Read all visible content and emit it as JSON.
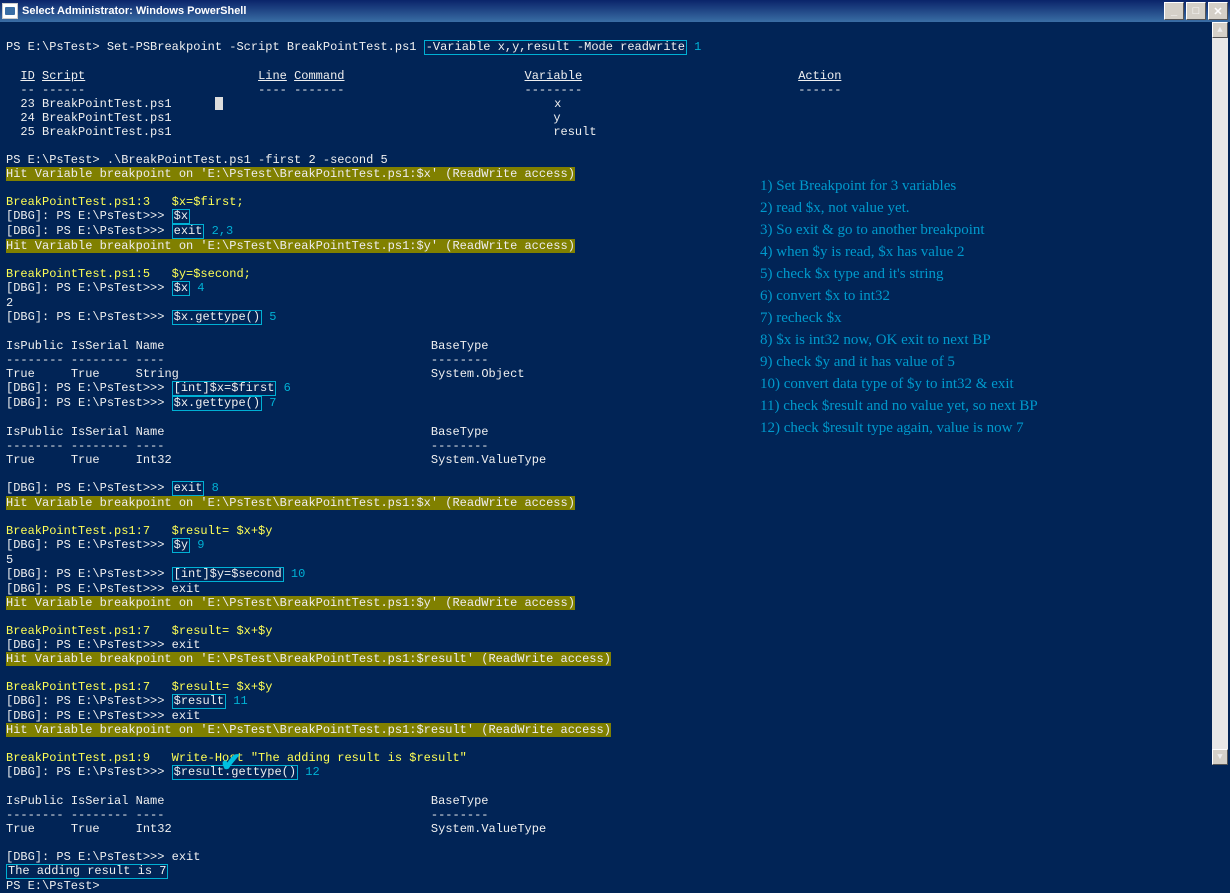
{
  "window": {
    "title": "Select Administrator: Windows PowerShell"
  },
  "cmd1": {
    "prompt": "PS E:\\PsTest> ",
    "cmd_start": "Set-PSBreakpoint -Script BreakPointTest.ps1 ",
    "boxed": "-Variable x,y,result -Mode readwrite",
    "annot": " 1"
  },
  "headers": {
    "id": "ID",
    "script": "Script",
    "line": "Line",
    "command": "Command",
    "variable": "Variable",
    "action": "Action",
    "id_u": "--",
    "script_u": "------",
    "line_u": "----",
    "command_u": "-------",
    "variable_u": "--------",
    "action_u": "------"
  },
  "rows": [
    {
      "id": "23",
      "script": "BreakPointTest.ps1",
      "var": "x"
    },
    {
      "id": "24",
      "script": "BreakPointTest.ps1",
      "var": "y"
    },
    {
      "id": "25",
      "script": "BreakPointTest.ps1",
      "var": "result"
    }
  ],
  "run": {
    "prompt": "PS E:\\PsTest> ",
    "cmd": ".\\BreakPointTest.ps1 -first 2 -second 5"
  },
  "hit_x": "Hit Variable breakpoint on 'E:\\PsTest\\BreakPointTest.ps1:$x' (ReadWrite access)",
  "hit_y": "Hit Variable breakpoint on 'E:\\PsTest\\BreakPointTest.ps1:$y' (ReadWrite access)",
  "hit_result": "Hit Variable breakpoint on 'E:\\PsTest\\BreakPointTest.ps1:$result' (ReadWrite access)",
  "line3": "BreakPointTest.ps1:3   $x=$first;",
  "line5": "BreakPointTest.ps1:5   $y=$second;",
  "line7": "BreakPointTest.ps1:7   $result= $x+$y",
  "line9": "BreakPointTest.ps1:9   Write-Host \"The adding result is $result\"",
  "dbg_prompt": "[DBG]: PS E:\\PsTest>>> ",
  "b23_x": "$x",
  "b23_exit": "exit",
  "a23": " 2,3",
  "b4_x": "$x",
  "a4": " 4",
  "v_2": "2",
  "b5_gettype": "$x.gettype()",
  "a5": " 5",
  "th": {
    "ispublic": "IsPublic",
    "isserial": "IsSerial",
    "name": "Name",
    "basetype": "BaseType",
    "ispublic_u": "--------",
    "isserial_u": "--------",
    "name_u": "----",
    "basetype_u": "--------"
  },
  "type_row_string": {
    "ispublic": "True",
    "isserial": "True",
    "name": "String",
    "basetype": "System.Object"
  },
  "type_row_int32": {
    "ispublic": "True",
    "isserial": "True",
    "name": "Int32",
    "basetype": "System.ValueType"
  },
  "b6_cast": "[int]$x=$first",
  "a6": " 6",
  "b7_gettype": "$x.gettype()",
  "a7": " 7",
  "b8_exit": "exit",
  "a8": " 8",
  "b9_y": "$y",
  "a9": " 9",
  "v_5": "5",
  "b10_cast": "[int]$y=$second",
  "a10": " 10",
  "b10_exit": "exit",
  "b11_result": "$result",
  "a11": " 11",
  "b12_gettype": "$result.gettype()",
  "a12": " 12",
  "final_result": "The adding result is 7",
  "ps_plain": "PS E:\\PsTest>",
  "notes": [
    "1) Set Breakpoint for 3 variables",
    "2) read $x, not value yet.",
    "3) So exit & go to another breakpoint",
    "4) when $y is read, $x has value 2",
    "5) check $x type and it's string",
    "6) convert $x to int32",
    "7) recheck $x",
    "8) $x is int32 now, OK exit to next BP",
    "9) check $y and it has value of 5",
    "10) convert data type of $y to int32 & exit",
    "11) check $result and no value yet, so next BP",
    "12) check $result type again, value is now 7"
  ]
}
